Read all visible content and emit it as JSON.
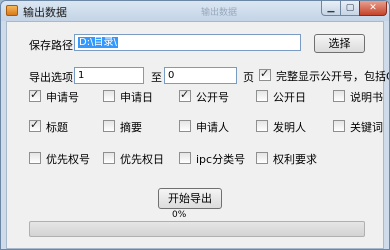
{
  "window": {
    "title": "输出数据",
    "ghost_title": "输出数据"
  },
  "path": {
    "label": "保存路径",
    "value": "D:\\目录\\",
    "browse_label": "选择"
  },
  "range": {
    "label": "导出选项",
    "from": "1",
    "to_label": "至",
    "to": "0",
    "unit": "页"
  },
  "full_display": {
    "label": "完整显示公开号，包括CN等",
    "checked": true
  },
  "fields": [
    {
      "label": "申请号",
      "checked": true
    },
    {
      "label": "申请日",
      "checked": false
    },
    {
      "label": "公开号",
      "checked": true
    },
    {
      "label": "公开日",
      "checked": false
    },
    {
      "label": "说明书",
      "checked": false
    },
    {
      "label": "标题",
      "checked": true
    },
    {
      "label": "摘要",
      "checked": false
    },
    {
      "label": "申请人",
      "checked": false
    },
    {
      "label": "发明人",
      "checked": false
    },
    {
      "label": "关键词",
      "checked": false
    },
    {
      "label": "优先权号",
      "checked": false
    },
    {
      "label": "优先权日",
      "checked": false
    },
    {
      "label": "ipc分类号",
      "checked": false
    },
    {
      "label": "权利要求",
      "checked": false
    }
  ],
  "start_label": "开始导出",
  "progress": {
    "percent_text": "0%",
    "value": 0
  },
  "check_mark": "✓"
}
